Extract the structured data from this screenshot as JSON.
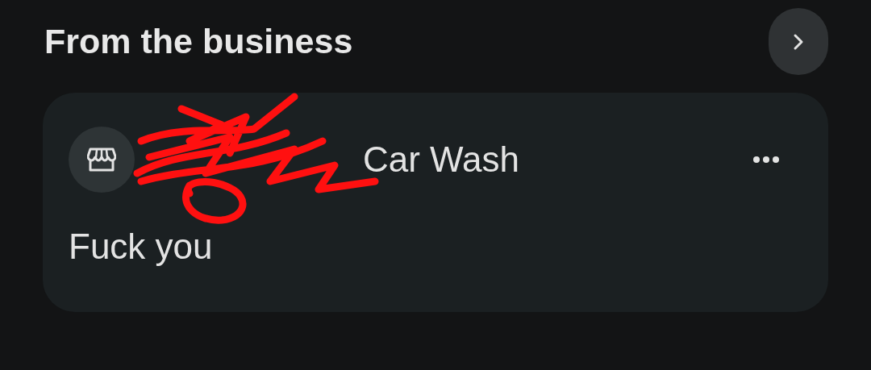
{
  "section": {
    "title": "From the business"
  },
  "post": {
    "business_name": "Car Wash",
    "text": "Fuck you"
  }
}
